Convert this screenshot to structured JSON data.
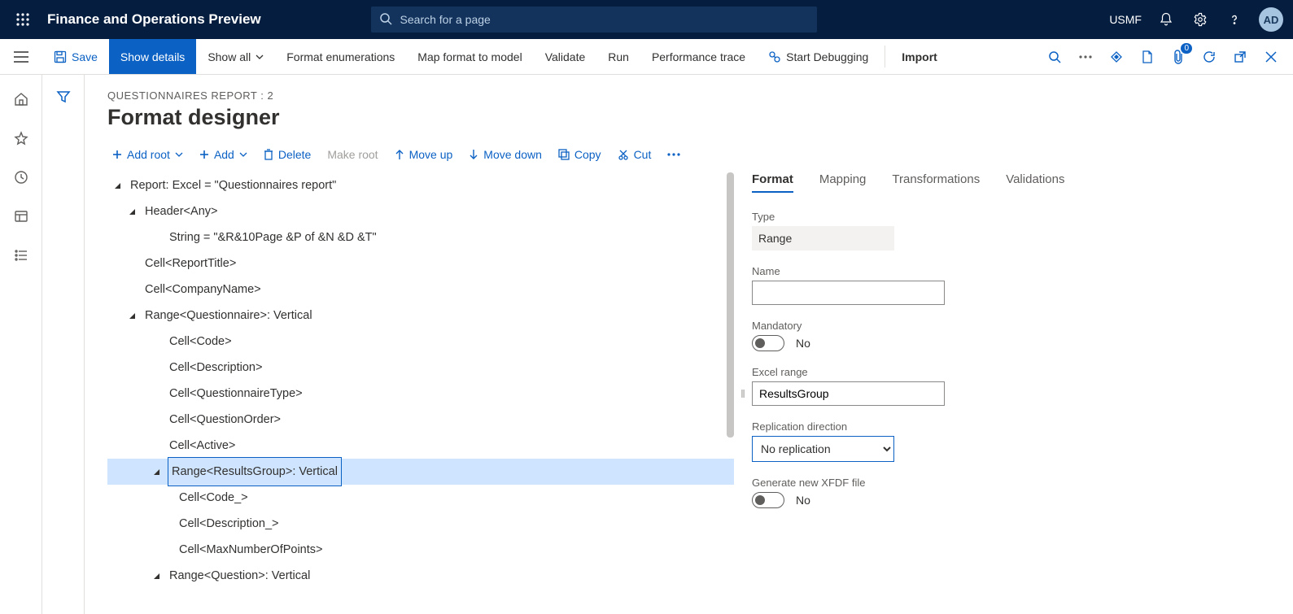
{
  "topbar": {
    "app_title": "Finance and Operations Preview",
    "search_placeholder": "Search for a page",
    "company_code": "USMF",
    "avatar_initials": "AD"
  },
  "cmdbar": {
    "save": "Save",
    "show_details": "Show details",
    "show_all": "Show all",
    "format_enum": "Format enumerations",
    "map_format": "Map format to model",
    "validate": "Validate",
    "run": "Run",
    "perf_trace": "Performance trace",
    "start_debug": "Start Debugging",
    "import": "Import",
    "attachment_badge": "0"
  },
  "page": {
    "breadcrumb": "QUESTIONNAIRES REPORT : 2",
    "title": "Format designer"
  },
  "toolbar2": {
    "add_root": "Add root",
    "add": "Add",
    "delete": "Delete",
    "make_root": "Make root",
    "move_up": "Move up",
    "move_down": "Move down",
    "copy": "Copy",
    "cut": "Cut"
  },
  "tree": [
    {
      "level": 0,
      "arrow": "▲",
      "label": "Report: Excel = \"Questionnaires report\"",
      "selected": false,
      "name": "node-report"
    },
    {
      "level": 1,
      "arrow": "▲",
      "label": "Header<Any>",
      "selected": false,
      "name": "node-header"
    },
    {
      "level": 2,
      "arrow": "",
      "label": "String = \"&R&10Page &P of &N &D &T\"",
      "selected": false,
      "name": "node-string"
    },
    {
      "level": 1,
      "arrow": "",
      "label": "Cell<ReportTitle>",
      "selected": false,
      "name": "node-reporttitle"
    },
    {
      "level": 1,
      "arrow": "",
      "label": "Cell<CompanyName>",
      "selected": false,
      "name": "node-companyname"
    },
    {
      "level": 1,
      "arrow": "▲",
      "label": "Range<Questionnaire>: Vertical",
      "selected": false,
      "name": "node-questionnaire"
    },
    {
      "level": 2,
      "arrow": "",
      "label": "Cell<Code>",
      "selected": false,
      "name": "node-code"
    },
    {
      "level": 2,
      "arrow": "",
      "label": "Cell<Description>",
      "selected": false,
      "name": "node-description"
    },
    {
      "level": 2,
      "arrow": "",
      "label": "Cell<QuestionnaireType>",
      "selected": false,
      "name": "node-qtype"
    },
    {
      "level": 2,
      "arrow": "",
      "label": "Cell<QuestionOrder>",
      "selected": false,
      "name": "node-qorder"
    },
    {
      "level": 2,
      "arrow": "",
      "label": "Cell<Active>",
      "selected": false,
      "name": "node-active"
    },
    {
      "level": 2,
      "arrow": "▲",
      "label": "Range<ResultsGroup>: Vertical",
      "selected": true,
      "name": "node-resultsgroup",
      "insetArrow": true
    },
    {
      "level": 3,
      "arrow": "",
      "label": "Cell<Code_>",
      "selected": false,
      "name": "node-code2"
    },
    {
      "level": 3,
      "arrow": "",
      "label": "Cell<Description_>",
      "selected": false,
      "name": "node-desc2"
    },
    {
      "level": 3,
      "arrow": "",
      "label": "Cell<MaxNumberOfPoints>",
      "selected": false,
      "name": "node-maxpoints"
    },
    {
      "level": 2,
      "arrow": "▲",
      "label": "Range<Question>: Vertical",
      "selected": false,
      "name": "node-question"
    }
  ],
  "tabs": {
    "format": "Format",
    "mapping": "Mapping",
    "transformations": "Transformations",
    "validations": "Validations"
  },
  "props": {
    "type_label": "Type",
    "type_value": "Range",
    "name_label": "Name",
    "name_value": "",
    "mandatory_label": "Mandatory",
    "mandatory_value": "No",
    "excel_range_label": "Excel range",
    "excel_range_value": "ResultsGroup",
    "replication_label": "Replication direction",
    "replication_value": "No replication",
    "xfdf_label": "Generate new XFDF file",
    "xfdf_value": "No"
  }
}
